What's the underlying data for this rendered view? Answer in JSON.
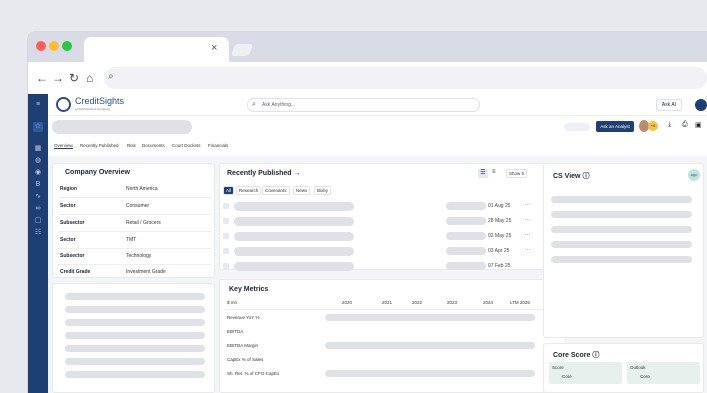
{
  "brand": {
    "name": "CreditSights",
    "tagline": "a FitchSolutions Company"
  },
  "search": {
    "placeholder": "Ask Anything..."
  },
  "top": {
    "ask_ai": "Ask AI",
    "ask_analyst": "Ask an Analyst",
    "badge": "+4"
  },
  "tabs": [
    "Overview",
    "Recently Published",
    "Risk",
    "Documents",
    "Court Dockets",
    "Financials"
  ],
  "overview": {
    "title": "Company Overview",
    "rows": [
      {
        "label": "Region",
        "value": "North America"
      },
      {
        "label": "Sector",
        "value": "Consumer"
      },
      {
        "label": "Subsector",
        "value": "Retail / Grocers"
      },
      {
        "label": "Sector",
        "value": "TMT"
      },
      {
        "label": "Subsector",
        "value": "Technology"
      },
      {
        "label": "Credit Grade",
        "value": "Investment Grade"
      }
    ]
  },
  "recent": {
    "title": "Recently Published",
    "arrow": "→",
    "show": "Show 5",
    "filters": [
      "All",
      "Research",
      "Covenants",
      "News",
      "Bixby"
    ],
    "dates": [
      "01 Aug 25",
      "28 May 25",
      "02 May 25",
      "03 Apr 25",
      "07 Feb 25"
    ],
    "more": "···"
  },
  "metrics": {
    "title": "Key Metrics",
    "unit": "$ mn",
    "years": [
      "2020",
      "2021",
      "2022",
      "2023",
      "2024",
      "LTM 2025"
    ],
    "rows": [
      "Revenue YoY %",
      "EBITDA",
      "EBITDA Margin",
      "CapEx % of Sales",
      "Sh. Ret. % of CFO-CapEx"
    ]
  },
  "csview": {
    "title": "CS View",
    "info": "ⓘ",
    "avatar": "agn"
  },
  "core": {
    "title": "Core Score",
    "info": "ⓘ",
    "score_label": "Score",
    "outlook_label": "Outlook",
    "score_value": "Core",
    "outlook_value": "Core"
  },
  "colors": {
    "rail": "#1e3f73",
    "accent": "#2b4b8c"
  }
}
